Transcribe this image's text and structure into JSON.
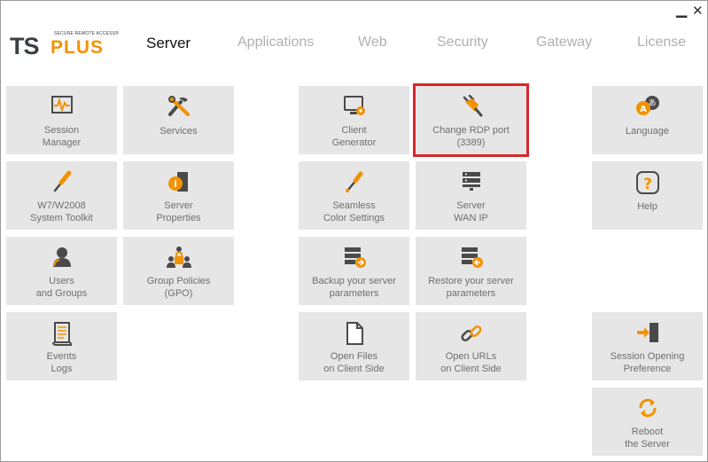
{
  "window": {
    "minimize_icon": "minimize-icon",
    "close_icon": "close-icon"
  },
  "logo": {
    "ts": "TS",
    "plus": "PLUS",
    "tagline": "SECURE REMOTE ACCESS®"
  },
  "tabs": [
    {
      "label": "Server",
      "active": true
    },
    {
      "label": "Applications",
      "active": false
    },
    {
      "label": "Web",
      "active": false
    },
    {
      "label": "Security",
      "active": false
    },
    {
      "label": "Gateway",
      "active": false
    },
    {
      "label": "License",
      "active": false
    }
  ],
  "tiles": {
    "session_manager": {
      "label": "Session\nManager",
      "icon": "monitor-graph-icon"
    },
    "services": {
      "label": "Services",
      "icon": "tools-icon"
    },
    "client_generator": {
      "label": "Client\nGenerator",
      "icon": "computer-icon"
    },
    "change_rdp_port": {
      "label": "Change RDP port\n(3389)",
      "icon": "plug-icon",
      "highlighted": true
    },
    "language": {
      "label": "Language",
      "icon": "language-icon"
    },
    "system_toolkit": {
      "label": "W7/W2008\nSystem Toolkit",
      "icon": "screwdriver-icon"
    },
    "server_properties": {
      "label": "Server\nProperties",
      "icon": "server-info-icon"
    },
    "seamless_color": {
      "label": "Seamless\nColor Settings",
      "icon": "eyedropper-icon"
    },
    "server_wan_ip": {
      "label": "Server\nWAN IP",
      "icon": "server-rack-icon"
    },
    "help": {
      "label": "Help",
      "icon": "question-icon"
    },
    "users_groups": {
      "label": "Users\nand Groups",
      "icon": "user-icon"
    },
    "group_policies": {
      "label": "Group Policies\n(GPO)",
      "icon": "group-lock-icon"
    },
    "backup_params": {
      "label": "Backup your server\nparameters",
      "icon": "server-backup-icon"
    },
    "restore_params": {
      "label": "Restore your server\nparameters",
      "icon": "server-restore-icon"
    },
    "events_logs": {
      "label": "Events\nLogs",
      "icon": "scroll-icon"
    },
    "open_files": {
      "label": "Open Files\non Client Side",
      "icon": "file-icon"
    },
    "open_urls": {
      "label": "Open URLs\non Client Side",
      "icon": "link-icon"
    },
    "session_opening": {
      "label": "Session Opening\nPreference",
      "icon": "door-arrow-icon"
    },
    "reboot": {
      "label": "Reboot\nthe Server",
      "icon": "refresh-icon"
    }
  },
  "colors": {
    "accent": "#f39200",
    "icon_dark": "#4a4a4a",
    "tile_bg": "#e6e6e6",
    "highlight": "#d9262b"
  }
}
